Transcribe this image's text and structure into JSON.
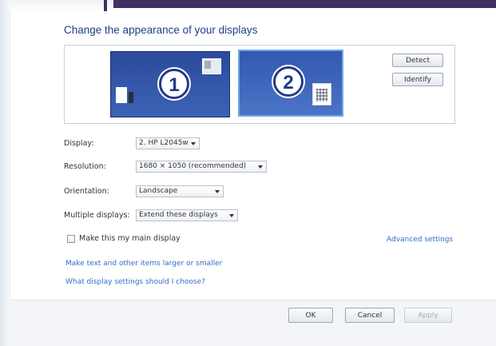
{
  "header": {
    "title": "Change the appearance of your displays"
  },
  "preview": {
    "monitors": [
      {
        "number": "1"
      },
      {
        "number": "2"
      }
    ],
    "detect_label": "Detect",
    "identify_label": "Identify"
  },
  "settings": {
    "display_label": "Display:",
    "display_value": "2. HP L2045w",
    "resolution_label": "Resolution:",
    "resolution_value": "1680 × 1050 (recommended)",
    "orientation_label": "Orientation:",
    "orientation_value": "Landscape",
    "multiple_label": "Multiple displays:",
    "multiple_value": "Extend these displays"
  },
  "options": {
    "main_display_label": "Make this my main display",
    "main_display_checked": false,
    "advanced_link": "Advanced settings",
    "text_size_link": "Make text and other items larger or smaller",
    "which_settings_link": "What display settings should I choose?"
  },
  "footer": {
    "ok_label": "OK",
    "cancel_label": "Cancel",
    "apply_label": "Apply"
  },
  "colors": {
    "title": "#1e3f8a",
    "link": "#2f6fc8",
    "monitor_fill": "#2b4a9d",
    "selected_monitor_border": "#6fa8e8"
  }
}
